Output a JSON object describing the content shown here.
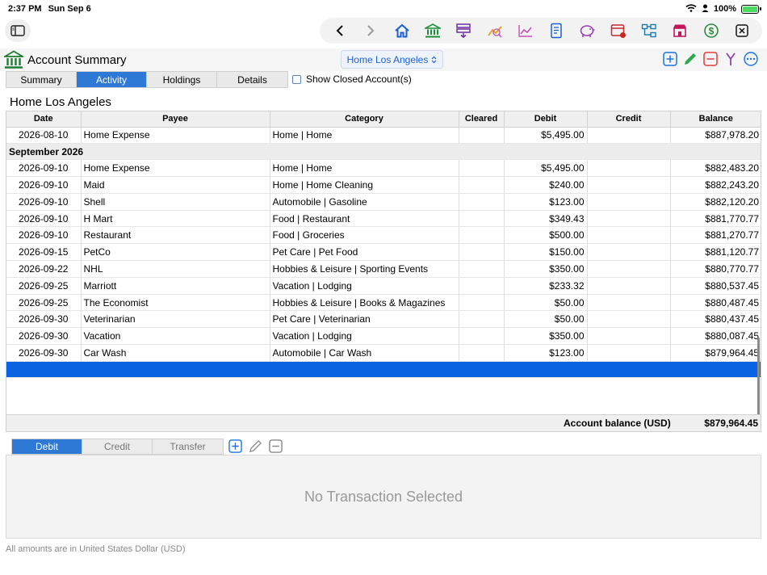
{
  "status": {
    "time": "2:37 PM",
    "date": "Sun Sep 6",
    "battery": "100%",
    "battery_level": 1.0
  },
  "toolbar": {
    "icons": [
      "chevron-left-icon",
      "chevron-right-icon",
      "home-icon",
      "bank-icon",
      "budget-icon",
      "trend-icon",
      "chart-line-icon",
      "report-icon",
      "piggy-bank-icon",
      "calendar-icon",
      "hierarchy-icon",
      "store-icon",
      "dollar-icon",
      "close-icon"
    ]
  },
  "header": {
    "title": "Account Summary",
    "account": "Home Los Angeles"
  },
  "tabs": [
    {
      "label": "Summary",
      "active": false
    },
    {
      "label": "Activity",
      "active": true
    },
    {
      "label": "Holdings",
      "active": false
    },
    {
      "label": "Details",
      "active": false
    }
  ],
  "show_closed": {
    "label": "Show Closed Account(s)",
    "checked": false
  },
  "section": {
    "title": "Home Los Angeles"
  },
  "table": {
    "columns": [
      "Date",
      "Payee",
      "Category",
      "Cleared",
      "Debit",
      "Credit",
      "Balance"
    ],
    "rows": [
      {
        "type": "row",
        "date": "2026-08-10",
        "payee": "Home Expense",
        "category": "Home | Home",
        "cleared": "",
        "debit": "$5,495.00",
        "credit": "",
        "balance": "$887,978.20"
      },
      {
        "type": "month",
        "label": "September 2026"
      },
      {
        "type": "row",
        "date": "2026-09-10",
        "payee": "Home Expense",
        "category": "Home | Home",
        "cleared": "",
        "debit": "$5,495.00",
        "credit": "",
        "balance": "$882,483.20"
      },
      {
        "type": "row",
        "date": "2026-09-10",
        "payee": "Maid",
        "category": "Home | Home Cleaning",
        "cleared": "",
        "debit": "$240.00",
        "credit": "",
        "balance": "$882,243.20"
      },
      {
        "type": "row",
        "date": "2026-09-10",
        "payee": "Shell",
        "category": "Automobile | Gasoline",
        "cleared": "",
        "debit": "$123.00",
        "credit": "",
        "balance": "$882,120.20"
      },
      {
        "type": "row",
        "date": "2026-09-10",
        "payee": "H Mart",
        "category": "Food | Restaurant",
        "cleared": "",
        "debit": "$349.43",
        "credit": "",
        "balance": "$881,770.77"
      },
      {
        "type": "row",
        "date": "2026-09-10",
        "payee": "Restaurant",
        "category": "Food | Groceries",
        "cleared": "",
        "debit": "$500.00",
        "credit": "",
        "balance": "$881,270.77"
      },
      {
        "type": "row",
        "date": "2026-09-15",
        "payee": "PetCo",
        "category": "Pet Care | Pet Food",
        "cleared": "",
        "debit": "$150.00",
        "credit": "",
        "balance": "$881,120.77"
      },
      {
        "type": "row",
        "date": "2026-09-22",
        "payee": "NHL",
        "category": "Hobbies & Leisure | Sporting Events",
        "cleared": "",
        "debit": "$350.00",
        "credit": "",
        "balance": "$880,770.77"
      },
      {
        "type": "row",
        "date": "2026-09-25",
        "payee": "Marriott",
        "category": "Vacation | Lodging",
        "cleared": "",
        "debit": "$233.32",
        "credit": "",
        "balance": "$880,537.45"
      },
      {
        "type": "row",
        "date": "2026-09-25",
        "payee": "The Economist",
        "category": "Hobbies & Leisure | Books & Magazines",
        "cleared": "",
        "debit": "$50.00",
        "credit": "",
        "balance": "$880,487.45"
      },
      {
        "type": "row",
        "date": "2026-09-30",
        "payee": "Veterinarian",
        "category": "Pet Care | Veterinarian",
        "cleared": "",
        "debit": "$50.00",
        "credit": "",
        "balance": "$880,437.45"
      },
      {
        "type": "row",
        "date": "2026-09-30",
        "payee": "Vacation",
        "category": "Vacation | Lodging",
        "cleared": "",
        "debit": "$350.00",
        "credit": "",
        "balance": "$880,087.45"
      },
      {
        "type": "row",
        "date": "2026-09-30",
        "payee": "Car Wash",
        "category": "Automobile | Car Wash",
        "cleared": "",
        "debit": "$123.00",
        "credit": "",
        "balance": "$879,964.45"
      },
      {
        "type": "selected"
      }
    ],
    "balance_label": "Account balance (USD)",
    "balance_value": "$879,964.45"
  },
  "entry_tabs": [
    {
      "label": "Debit",
      "active": true
    },
    {
      "label": "Credit",
      "active": false
    },
    {
      "label": "Transfer",
      "active": false
    }
  ],
  "detail": {
    "empty_text": "No Transaction Selected"
  },
  "footer": {
    "note": "All amounts are in United States Dollar (USD)"
  },
  "colors": {
    "accent": "#2e78d6",
    "selection": "#0a63e0",
    "add": "#1a73e8",
    "edit": "#2fa84f",
    "delete": "#e53935",
    "split": "#8e44ad"
  }
}
